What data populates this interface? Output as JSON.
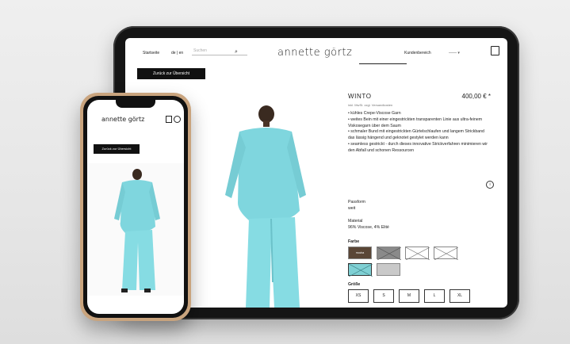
{
  "nav": {
    "home": "Startseite",
    "lang": "de | en",
    "search_placeholder": "Suchen",
    "account": "Kundenbereich",
    "account_select": "—— ▾"
  },
  "brand": {
    "logo": "annette görtz"
  },
  "back_button": "Zurück zur Übersicht",
  "product": {
    "title": "WINTO",
    "price": "400,00 € *",
    "tax_note": "inkl. MwSt. zzgl. Versandkosten",
    "bullets": [
      "• kühles Crepe-Viscose Garn",
      "• weites Bein mit einer eingestrickten transparenten Linie aus ultra-feinem Viskosegarn über dem Saum",
      "• schmaler Bund mit eingestrickten Gürtelschlaufen und langem Strickband das lässig hängend und geknotet gestylet werden kann",
      "• seamless gestrickt - durch dieses innovative Strickverfahren minimieren wir den Abfall und schonen Ressourcen"
    ],
    "fit_label": "Passform",
    "fit_value": "weit",
    "material_label": "Material",
    "material_value": "96% Viscose, 4% Elité",
    "color_label": "Farbe",
    "size_label": "Größe",
    "swatches": [
      {
        "label": "mocha",
        "color": "#5a4636",
        "available": true
      },
      {
        "label": "",
        "color": "#888888",
        "available": false
      },
      {
        "label": "",
        "color": "#ffffff",
        "available": false
      },
      {
        "label": "",
        "color": "#ffffff",
        "available": false
      },
      {
        "label": "",
        "color": "#7fd0d4",
        "available": false
      },
      {
        "label": "",
        "color": "#c9c9c9",
        "available": true
      }
    ],
    "sizes": [
      "XS",
      "S",
      "M",
      "L",
      "XL"
    ]
  },
  "colors": {
    "accent": "#111111",
    "garment": "#7fd6de"
  }
}
